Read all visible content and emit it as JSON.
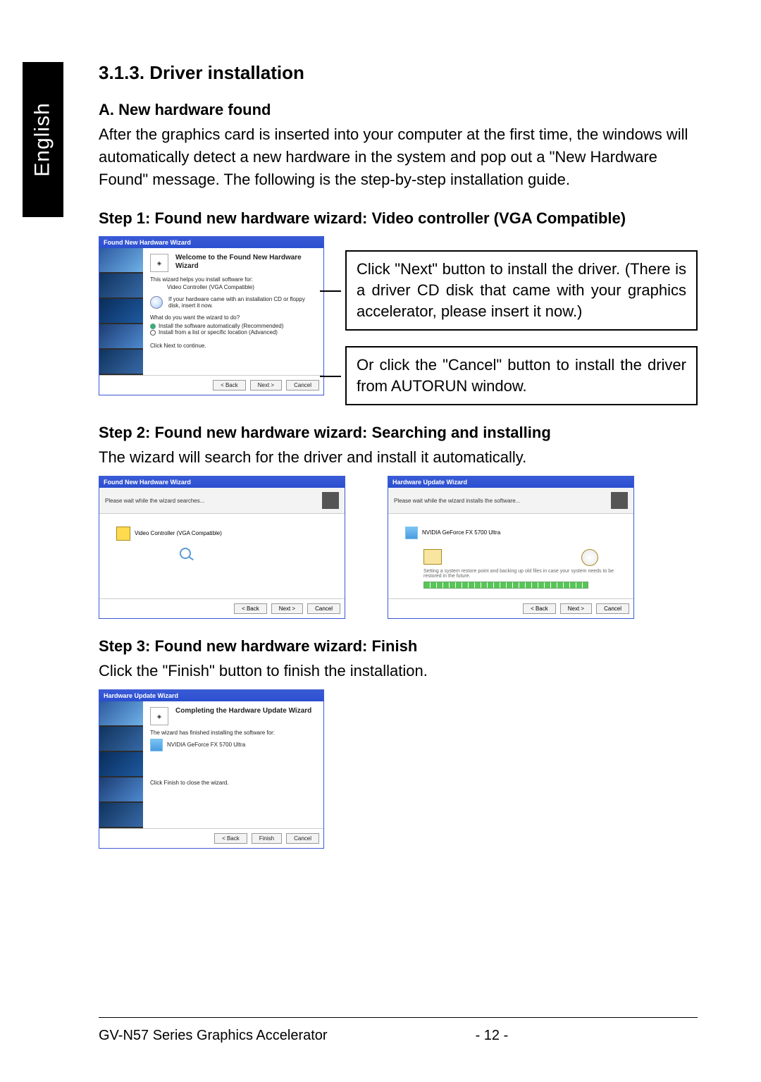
{
  "language_tab": "English",
  "section_heading": "3.1.3. Driver installation",
  "subA_heading": "A. New hardware found",
  "subA_body": "After the graphics card is inserted into your computer at the first time, the windows will automatically detect a new hardware in the system and pop out a \"New Hardware Found\" message. The following is the step-by-step installation guide.",
  "step1_heading": "Step 1: Found new hardware wizard: Video controller (VGA Compatible)",
  "wizard1": {
    "titlebar": "Found New Hardware Wizard",
    "title": "Welcome to the Found New Hardware Wizard",
    "line1": "This wizard helps you install software for:",
    "line2": "Video Controller (VGA Compatible)",
    "cd_hint": "If your hardware came with an installation CD or floppy disk, insert it now.",
    "prompt": "What do you want the wizard to do?",
    "opt1": "Install the software automatically (Recommended)",
    "opt2": "Install from a list or specific location (Advanced)",
    "continue_hint": "Click Next to continue.",
    "btn_back": "< Back",
    "btn_next": "Next >",
    "btn_cancel": "Cancel"
  },
  "callout1": "Click \"Next\" button to install the driver. (There is a driver CD disk that came with your graphics accelerator, please insert it now.)",
  "callout2": "Or click the \"Cancel\" button to install the driver from AUTORUN window.",
  "step2_heading": "Step 2: Found new hardware wizard: Searching and installing",
  "step2_body": "The wizard will search for the driver and install it automatically.",
  "wizard2a": {
    "titlebar": "Found New Hardware Wizard",
    "subtitle": "Please wait while the wizard searches...",
    "device": "Video Controller (VGA Compatible)",
    "btn_back": "< Back",
    "btn_next": "Next >",
    "btn_cancel": "Cancel"
  },
  "wizard2b": {
    "titlebar": "Hardware Update Wizard",
    "subtitle": "Please wait while the wizard installs the software...",
    "device": "NVIDIA GeForce FX 5700 Ultra",
    "copy_label": "Setting a system restore point and backing up old files in case your system needs to be restored in the future.",
    "btn_back": "< Back",
    "btn_next": "Next >",
    "btn_cancel": "Cancel"
  },
  "step3_heading": "Step 3: Found new hardware wizard: Finish",
  "step3_body": "Click the \"Finish\" button to finish the installation.",
  "wizard3": {
    "titlebar": "Hardware Update Wizard",
    "title": "Completing the Hardware Update Wizard",
    "line1": "The wizard has finished installing the software for:",
    "device": "NVIDIA GeForce FX 5700 Ultra",
    "close_hint": "Click Finish to close the wizard.",
    "btn_back": "< Back",
    "btn_finish": "Finish",
    "btn_cancel": "Cancel"
  },
  "footer_text": "GV-N57 Series Graphics Accelerator",
  "footer_page": "- 12 -"
}
